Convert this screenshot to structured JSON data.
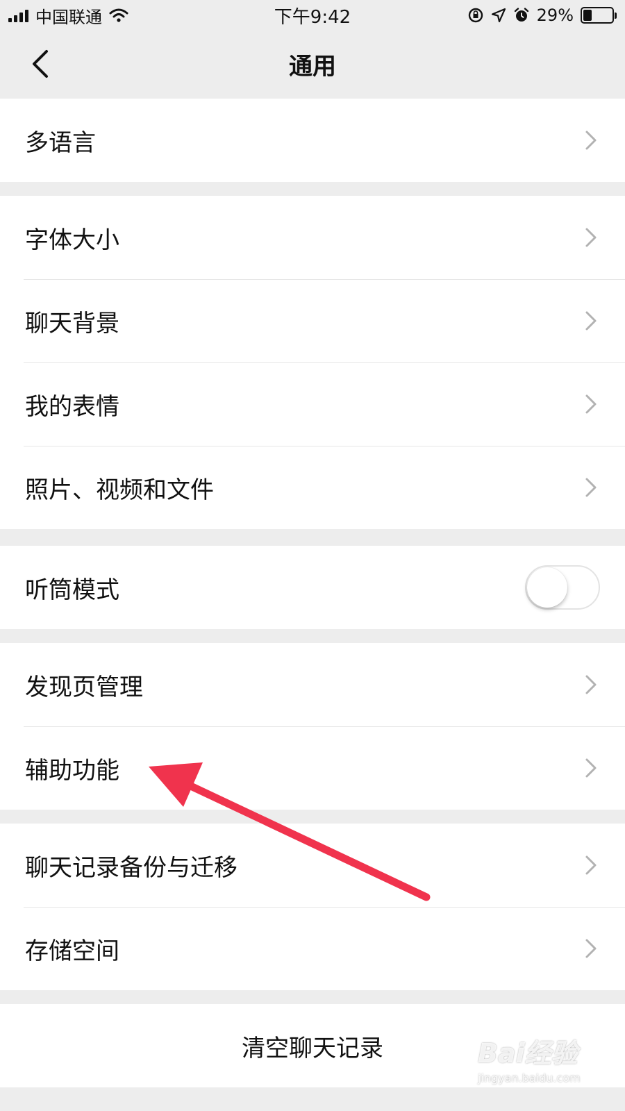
{
  "status_bar": {
    "carrier": "中国联通",
    "time": "下午9:42",
    "battery_percent_text": "29%",
    "battery_level": 0.29,
    "icons": [
      "signal-icon",
      "wifi-icon",
      "orientation-lock-icon",
      "location-icon",
      "alarm-icon",
      "battery-icon"
    ]
  },
  "nav": {
    "back_icon": "chevron-left-icon",
    "title": "通用"
  },
  "groups": [
    {
      "items": [
        {
          "label": "多语言",
          "accessory": "chevron"
        }
      ]
    },
    {
      "items": [
        {
          "label": "字体大小",
          "accessory": "chevron"
        },
        {
          "label": "聊天背景",
          "accessory": "chevron"
        },
        {
          "label": "我的表情",
          "accessory": "chevron"
        },
        {
          "label": "照片、视频和文件",
          "accessory": "chevron"
        }
      ]
    },
    {
      "items": [
        {
          "label": "听筒模式",
          "accessory": "toggle",
          "toggle_on": false
        }
      ]
    },
    {
      "items": [
        {
          "label": "发现页管理",
          "accessory": "chevron"
        },
        {
          "label": "辅助功能",
          "accessory": "chevron"
        }
      ]
    },
    {
      "items": [
        {
          "label": "聊天记录备份与迁移",
          "accessory": "chevron"
        },
        {
          "label": "存储空间",
          "accessory": "chevron"
        }
      ]
    },
    {
      "items": [
        {
          "label": "清空聊天记录",
          "accessory": "none"
        }
      ]
    }
  ],
  "annotation": {
    "type": "arrow",
    "color": "#f0334d",
    "points_to": "辅助功能"
  },
  "watermark": {
    "line1": "Bai经验",
    "line2": "jingyan.baidu.com"
  },
  "colors": {
    "background": "#ededed",
    "cell": "#ffffff",
    "text": "#111111",
    "chevron": "#b2b2b2",
    "separator": "#e6e6e6"
  }
}
